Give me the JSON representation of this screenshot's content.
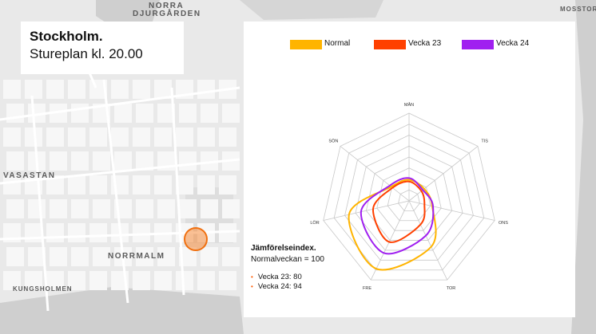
{
  "map": {
    "labels": {
      "norra_1": "NORRA",
      "norra_2": "DJURGÅRDEN",
      "mosstorp": "MOSSTORP",
      "vasastan": "VASASTAN",
      "norrmalm": "NORRMALM",
      "kungsholmen": "KUNGSHOLMEN"
    },
    "colors": {
      "land": "#e9e9e9",
      "block": "#f7f7f7",
      "water": "#cfcfcf",
      "road": "#ffffff",
      "park": "#dcdcdc"
    }
  },
  "title_card": {
    "city": "Stockholm.",
    "subtitle": "Stureplan kl. 20.00"
  },
  "marker": {
    "icon": "location-circle-icon",
    "color": "#f07010"
  },
  "chart_data": {
    "type": "radar",
    "axes": [
      "MÅN",
      "TIS",
      "ONS",
      "TOR",
      "FRE",
      "LÖR",
      "SÖN"
    ],
    "series": [
      {
        "name": "Normal",
        "color": "#ffb400",
        "values": [
          24,
          22,
          27,
          58,
          86,
          70,
          26
        ]
      },
      {
        "name": "Vecka 23",
        "color": "#ff4000",
        "values": [
          22,
          18,
          18,
          30,
          52,
          42,
          24
        ]
      },
      {
        "name": "Vecka 24",
        "color": "#a020f0",
        "values": [
          26,
          20,
          28,
          44,
          66,
          56,
          28
        ]
      }
    ],
    "range": [
      0,
      100
    ],
    "rings": 8,
    "legend_position": "top",
    "index": {
      "title": "Jämförelseindex.",
      "normal": "Normalveckan = 100",
      "rows": [
        "Vecka 23: 80",
        "Vecka 24: 94"
      ],
      "bullet_color": "#ff5a00"
    }
  }
}
